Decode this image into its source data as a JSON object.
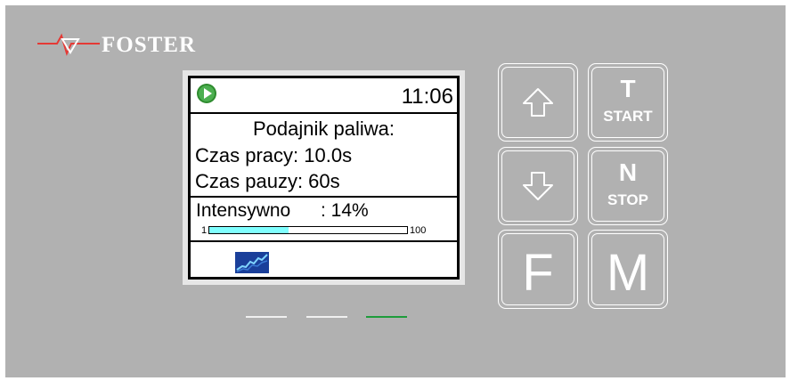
{
  "brand": {
    "name": "FOSTER",
    "logo_icon": "foster-heartbeat-logo"
  },
  "display": {
    "status_icon": "play-icon",
    "time": "11:06",
    "title": "Podajnik paliwa:",
    "work_time": "Czas pracy: 10.0s",
    "pause_time": "Czas pauzy: 60s",
    "intensity": {
      "label": "Intensywno",
      "value": ": 14%",
      "bar_min": "1",
      "bar_max": "100",
      "level_percent": 40
    },
    "bottom_icon": "trend-chart-icon"
  },
  "leds": [
    {
      "name": "led-1",
      "color": "#f0f0f0"
    },
    {
      "name": "led-2",
      "color": "#f0f0f0"
    },
    {
      "name": "led-3",
      "color": "#1e9c3b"
    }
  ],
  "keys": {
    "up": {
      "icon": "arrow-up-icon"
    },
    "down": {
      "icon": "arrow-down-icon"
    },
    "t": {
      "letter": "T",
      "sub": "START"
    },
    "n": {
      "letter": "N",
      "sub": "STOP"
    },
    "f": {
      "letter": "F"
    },
    "m": {
      "letter": "M"
    }
  }
}
